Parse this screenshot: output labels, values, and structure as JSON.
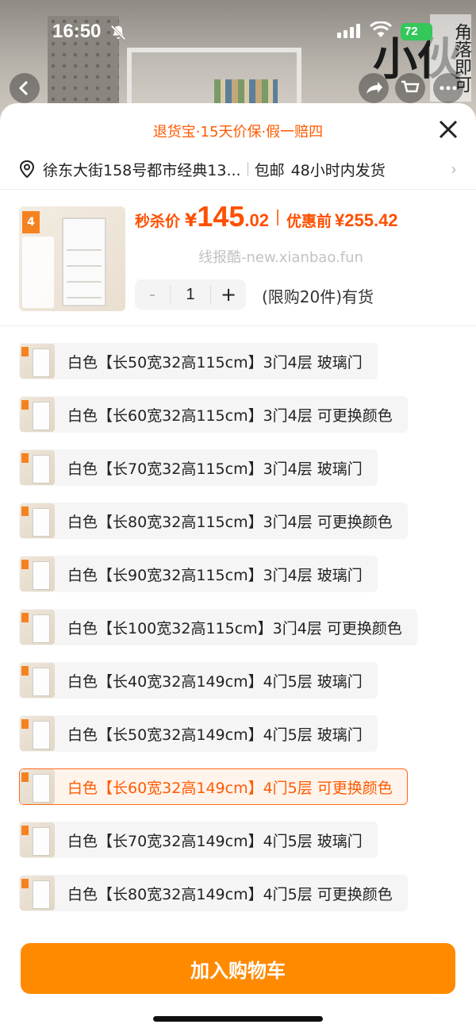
{
  "status": {
    "time": "16:50",
    "battery": "72"
  },
  "background": {
    "overlay_text": "角落即可",
    "big_char": "小伙"
  },
  "sheet": {
    "guarantee": "退货宝·15天价保·假一赔四",
    "address": "徐东大街158号都市经典13...",
    "shipping_free": "包邮",
    "shipping_time": "48小时内发货"
  },
  "product": {
    "thumb_tag": "4",
    "price_label": "秒杀价",
    "yen": "¥",
    "price_int": "145",
    "price_dec": ".02",
    "orig_label": "优惠前",
    "orig_price": "¥255.42",
    "watermark": "线报酷-new.xianbao.fun",
    "quantity": "1",
    "minus": "-",
    "plus": "+",
    "stock": "(限购20件)有货"
  },
  "options": [
    {
      "label": "白色【长50宽32高115cm】3门4层 玻璃门"
    },
    {
      "label": "白色【长60宽32高115cm】3门4层 可更换颜色"
    },
    {
      "label": "白色【长70宽32高115cm】3门4层 玻璃门"
    },
    {
      "label": "白色【长80宽32高115cm】3门4层 可更换颜色"
    },
    {
      "label": "白色【长90宽32高115cm】3门4层 玻璃门"
    },
    {
      "label": "白色【长100宽32高115cm】3门4层 可更换颜色"
    },
    {
      "label": "白色【长40宽32高149cm】4门5层 玻璃门"
    },
    {
      "label": "白色【长50宽32高149cm】4门5层 玻璃门"
    },
    {
      "label": "白色【长60宽32高149cm】4门5层 可更换颜色",
      "selected": true
    },
    {
      "label": "白色【长70宽32高149cm】4门5层 玻璃门"
    },
    {
      "label": "白色【长80宽32高149cm】4门5层 可更换颜色"
    }
  ],
  "cart_button": "加入购物车",
  "colors": {
    "accent": "#ff5a00",
    "cart": "#ff8a00",
    "battery": "#34c759"
  }
}
